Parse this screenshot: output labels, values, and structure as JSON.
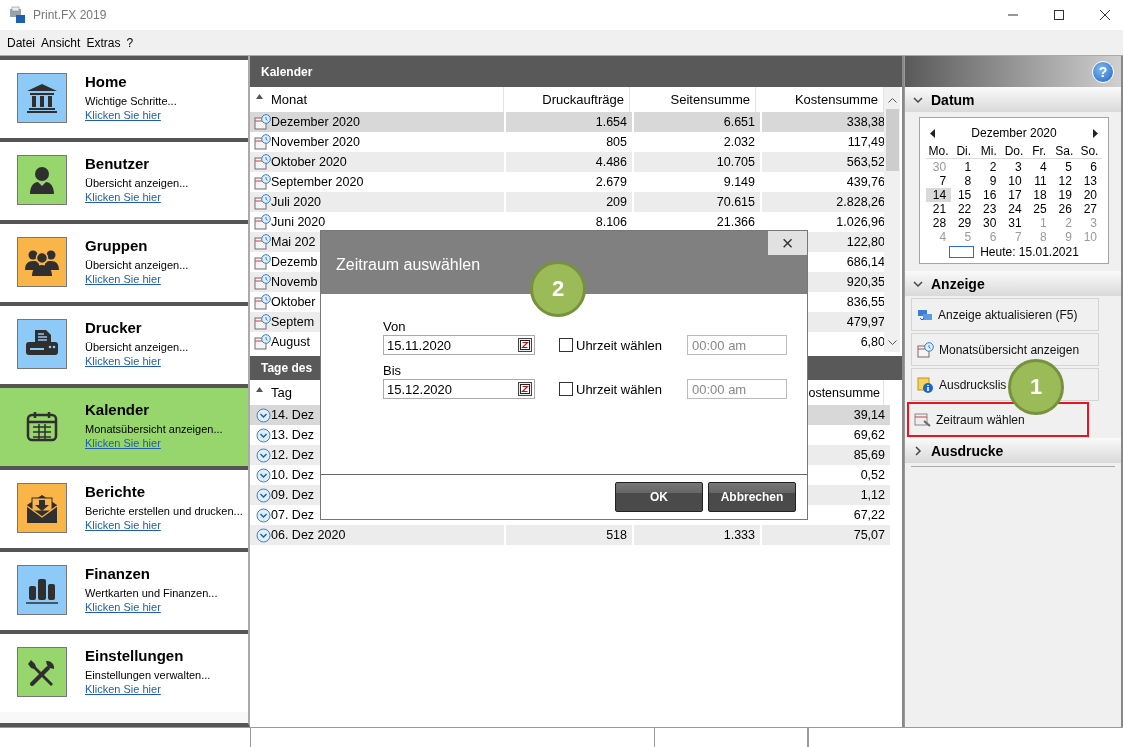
{
  "window": {
    "title": "Print.FX 2019"
  },
  "menu": [
    "Datei",
    "Ansicht",
    "Extras",
    "?"
  ],
  "sidebar": {
    "items": [
      {
        "title": "Home",
        "subtitle": "Wichtige Schritte...",
        "link": "Klicken Sie hier",
        "color": "#8ecaf8",
        "selected": false
      },
      {
        "title": "Benutzer",
        "subtitle": "Übersicht anzeigen...",
        "link": "Klicken Sie hier",
        "color": "#97d66c",
        "selected": false
      },
      {
        "title": "Gruppen",
        "subtitle": "Übersicht anzeigen...",
        "link": "Klicken Sie hier",
        "color": "#f9b548",
        "selected": false
      },
      {
        "title": "Drucker",
        "subtitle": "Übersicht anzeigen...",
        "link": "Klicken Sie hier",
        "color": "#8ecaf8",
        "selected": false
      },
      {
        "title": "Kalender",
        "subtitle": "Monatsübersicht anzeigen...",
        "link": "Klicken Sie hier",
        "color": "#97d66c",
        "selected": true
      },
      {
        "title": "Berichte",
        "subtitle": "Berichte erstellen und drucken...",
        "link": "Klicken Sie hier",
        "color": "#f9b548",
        "selected": false
      },
      {
        "title": "Finanzen",
        "subtitle": "Wertkarten und Finanzen...",
        "link": "Klicken Sie hier",
        "color": "#8ecaf8",
        "selected": false
      },
      {
        "title": "Einstellungen",
        "subtitle": "Einstellungen verwalten...",
        "link": "Klicken Sie hier",
        "color": "#97d66c",
        "selected": false
      }
    ]
  },
  "months_panel": {
    "title": "Kalender",
    "columns": {
      "month": "Monat",
      "jobs": "Druckaufträge",
      "pages": "Seitensumme",
      "cost": "Kostensumme"
    },
    "rows": [
      {
        "month": "Dezember 2020",
        "jobs": "1.654",
        "pages": "6.651",
        "cost": "338,38",
        "selected": true
      },
      {
        "month": "November 2020",
        "jobs": "805",
        "pages": "2.032",
        "cost": "117,49",
        "selected": false
      },
      {
        "month": "Oktober 2020",
        "jobs": "4.486",
        "pages": "10.705",
        "cost": "563,52",
        "selected": false
      },
      {
        "month": "September 2020",
        "jobs": "2.679",
        "pages": "9.149",
        "cost": "439,76",
        "selected": false
      },
      {
        "month": "Juli 2020",
        "jobs": "209",
        "pages": "70.615",
        "cost": "2.828,26",
        "selected": false
      },
      {
        "month": "Juni 2020",
        "jobs": "8.106",
        "pages": "21.366",
        "cost": "1.026,96",
        "selected": false
      },
      {
        "month": "Mai 202",
        "cost": "122,80",
        "selected": false
      },
      {
        "month": "Dezemb",
        "cost": "686,14",
        "selected": false
      },
      {
        "month": "Novemb",
        "cost": "920,35",
        "selected": false
      },
      {
        "month": "Oktober",
        "cost": "836,55",
        "selected": false
      },
      {
        "month": "Septem",
        "cost": "479,97",
        "selected": false
      },
      {
        "month": "August",
        "cost": "6,80",
        "selected": false
      }
    ]
  },
  "days_panel": {
    "title": "Tage des",
    "columns": {
      "month": "Tag",
      "cost": "ostensumme"
    },
    "rows": [
      {
        "month": "14. Dez",
        "cost": "39,14",
        "selected": true
      },
      {
        "month": "13. Dez",
        "cost": "69,62",
        "selected": false
      },
      {
        "month": "12. Dez",
        "cost": "85,69",
        "selected": false
      },
      {
        "month": "10. Dez",
        "cost": "0,52",
        "selected": false
      },
      {
        "month": "09. Dez",
        "cost": "1,12",
        "selected": false
      },
      {
        "month": "07. Dez",
        "cost": "67,22",
        "selected": false
      },
      {
        "month": "06. Dez 2020",
        "jobs": "518",
        "pages": "1.333",
        "cost": "75,07",
        "selected": false
      }
    ]
  },
  "right_panel": {
    "help": "?",
    "date_section": {
      "title": "Datum",
      "expanded": true,
      "calendar": {
        "month": "Dezember 2020",
        "weekdays": [
          "Mo.",
          "Di.",
          "Mi.",
          "Do.",
          "Fr.",
          "Sa.",
          "So."
        ],
        "weeks": [
          [
            {
              "day": "30",
              "other": true,
              "selected": false
            },
            {
              "day": "1",
              "other": false,
              "selected": false
            },
            {
              "day": "2",
              "other": false,
              "selected": false
            },
            {
              "day": "3",
              "other": false,
              "selected": false
            },
            {
              "day": "4",
              "other": false,
              "selected": false
            },
            {
              "day": "5",
              "other": false,
              "selected": false
            },
            {
              "day": "6",
              "other": false,
              "selected": false
            }
          ],
          [
            {
              "day": "7",
              "other": false,
              "selected": false
            },
            {
              "day": "8",
              "other": false,
              "selected": false
            },
            {
              "day": "9",
              "other": false,
              "selected": false
            },
            {
              "day": "10",
              "other": false,
              "selected": false
            },
            {
              "day": "11",
              "other": false,
              "selected": false
            },
            {
              "day": "12",
              "other": false,
              "selected": false
            },
            {
              "day": "13",
              "other": false,
              "selected": false
            }
          ],
          [
            {
              "day": "14",
              "other": false,
              "selected": true
            },
            {
              "day": "15",
              "other": false,
              "selected": false
            },
            {
              "day": "16",
              "other": false,
              "selected": false
            },
            {
              "day": "17",
              "other": false,
              "selected": false
            },
            {
              "day": "18",
              "other": false,
              "selected": false
            },
            {
              "day": "19",
              "other": false,
              "selected": false
            },
            {
              "day": "20",
              "other": false,
              "selected": false
            }
          ],
          [
            {
              "day": "21",
              "other": false,
              "selected": false
            },
            {
              "day": "22",
              "other": false,
              "selected": false
            },
            {
              "day": "23",
              "other": false,
              "selected": false
            },
            {
              "day": "24",
              "other": false,
              "selected": false
            },
            {
              "day": "25",
              "other": false,
              "selected": false
            },
            {
              "day": "26",
              "other": false,
              "selected": false
            },
            {
              "day": "27",
              "other": false,
              "selected": false
            }
          ],
          [
            {
              "day": "28",
              "other": false,
              "selected": false
            },
            {
              "day": "29",
              "other": false,
              "selected": false
            },
            {
              "day": "30",
              "other": false,
              "selected": false
            },
            {
              "day": "31",
              "other": false,
              "selected": false
            },
            {
              "day": "1",
              "other": true,
              "selected": false
            },
            {
              "day": "2",
              "other": true,
              "selected": false
            },
            {
              "day": "3",
              "other": true,
              "selected": false
            }
          ],
          [
            {
              "day": "4",
              "other": true,
              "selected": false
            },
            {
              "day": "5",
              "other": true,
              "selected": false
            },
            {
              "day": "6",
              "other": true,
              "selected": false
            },
            {
              "day": "7",
              "other": true,
              "selected": false
            },
            {
              "day": "8",
              "other": true,
              "selected": false
            },
            {
              "day": "9",
              "other": true,
              "selected": false
            },
            {
              "day": "10",
              "other": true,
              "selected": false
            }
          ]
        ],
        "today": "Heute: 15.01.2021"
      }
    },
    "view_section": {
      "title": "Anzeige",
      "expanded": true,
      "actions": [
        {
          "label": "Anzeige aktualisieren (F5)",
          "highlighted": false
        },
        {
          "label": "Monatsübersicht anzeigen",
          "highlighted": false
        },
        {
          "label": "Ausdruckslis",
          "highlighted": false
        },
        {
          "label": "Zeitraum wählen",
          "highlighted": true
        }
      ]
    },
    "prints_section": {
      "title": "Ausdrucke",
      "expanded": false
    }
  },
  "dialog": {
    "title": "Zeitraum auswählen",
    "close": "×",
    "fields": [
      {
        "label": "Von",
        "value": "15.11.2020",
        "time_checkbox": {
          "label": "Uhrzeit wählen",
          "checked": false
        },
        "time": "00:00 am"
      },
      {
        "label": "Bis",
        "value": "15.12.2020",
        "time_checkbox": {
          "label": "Uhrzeit wählen",
          "checked": false
        },
        "time": "00:00 am"
      }
    ],
    "buttons": [
      "OK",
      "Abbrechen"
    ]
  },
  "annotations": [
    {
      "label": "1"
    },
    {
      "label": "2"
    }
  ]
}
